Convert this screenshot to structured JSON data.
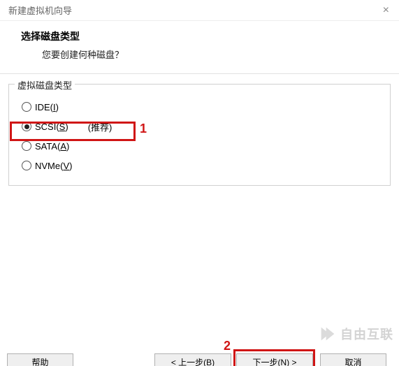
{
  "window": {
    "title": "新建虚拟机向导"
  },
  "header": {
    "title": "选择磁盘类型",
    "subtitle": "您要创建何种磁盘？"
  },
  "fieldset": {
    "legend": "虚拟磁盘类型"
  },
  "options": {
    "ide_prefix": "IDE(",
    "ide_mn": "I",
    "ide_suffix": ")",
    "scsi_prefix": "SCSI(",
    "scsi_mn": "S",
    "scsi_suffix": ")",
    "scsi_recommend": "(推荐)",
    "sata_prefix": "SATA(",
    "sata_mn": "A",
    "sata_suffix": ")",
    "nvme_prefix": "NVMe(",
    "nvme_mn": "V",
    "nvme_suffix": ")"
  },
  "buttons": {
    "help": "帮助",
    "back": "< 上一步(B)",
    "next": "下一步(N) >",
    "cancel": "取消"
  },
  "annotations": {
    "one": "1",
    "two": "2"
  },
  "watermark": {
    "text": "自由互联"
  }
}
